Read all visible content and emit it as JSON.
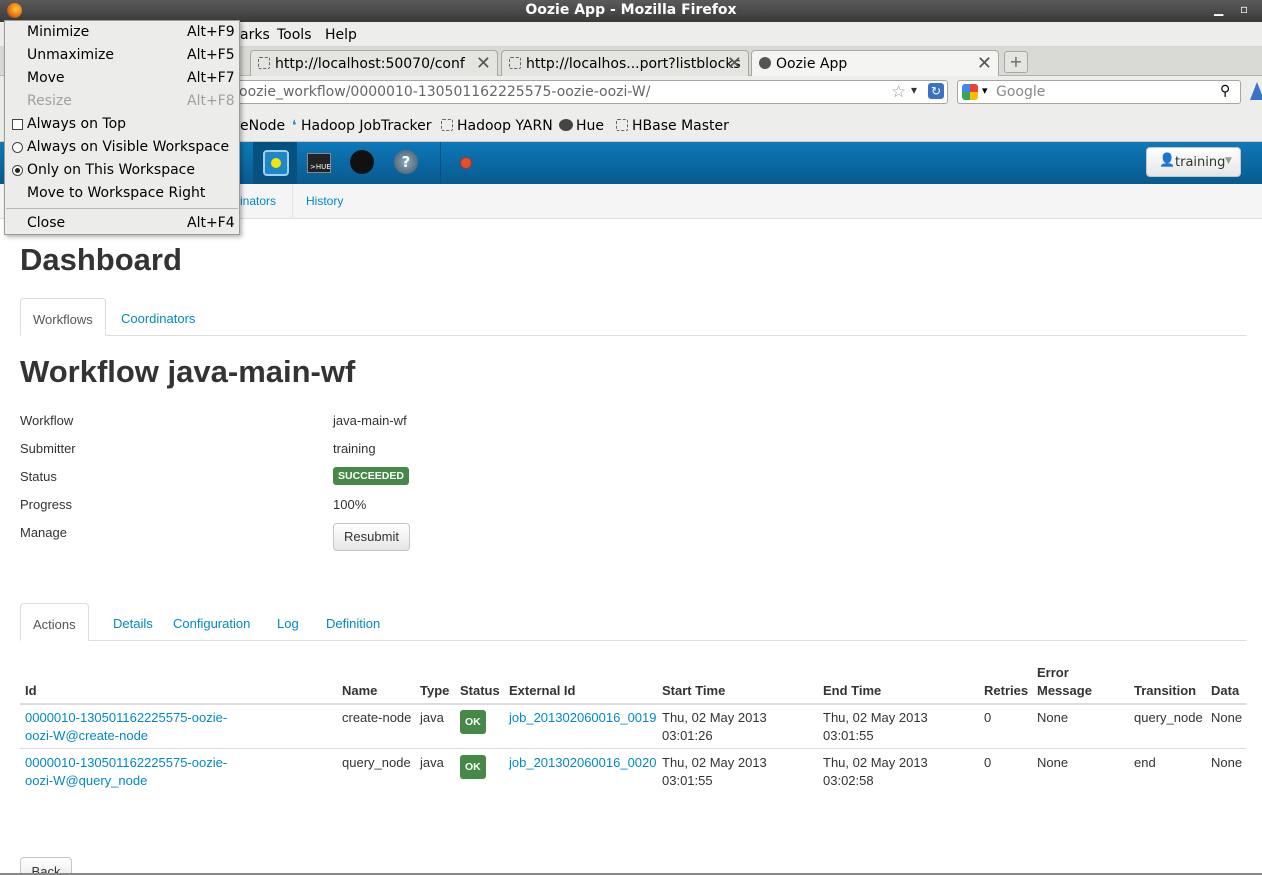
{
  "window": {
    "title": "Oozie App - Mozilla Firefox",
    "min_label": "▁",
    "close_label": "▫"
  },
  "menubar": {
    "bookmarks_partial": "arks",
    "tools": "Tools",
    "help": "Help"
  },
  "tabs": [
    {
      "label": "http://localhost:50070/conf"
    },
    {
      "label": "http://localhos...port?listblocks"
    },
    {
      "label": "Oozie App"
    }
  ],
  "newtab_label": "+",
  "url": "oozie_workflow/0000010-130501162225575-oozie-oozi-W/",
  "search": {
    "placeholder": "Google"
  },
  "bookmarks": [
    {
      "label": "eNode"
    },
    {
      "label": "Hadoop JobTracker"
    },
    {
      "label": "Hadoop YARN"
    },
    {
      "label": "Hue"
    },
    {
      "label": "HBase Master"
    }
  ],
  "hue_nav": {
    "user": "training",
    "hue_icon_text": ">HUE",
    "help_icon_text": "?"
  },
  "subnav": {
    "coordinators_partial": "inators",
    "history": "History"
  },
  "page_title": "Dashboard",
  "dashboard_tabs": {
    "workflows": "Workflows",
    "coordinators": "Coordinators"
  },
  "workflow_title": "Workflow java-main-wf",
  "properties": {
    "workflow": {
      "label": "Workflow",
      "value": "java-main-wf"
    },
    "submitter": {
      "label": "Submitter",
      "value": "training"
    },
    "status": {
      "label": "Status",
      "value": "SUCCEEDED"
    },
    "progress": {
      "label": "Progress",
      "value": "100%"
    },
    "manage": {
      "label": "Manage",
      "button": "Resubmit"
    }
  },
  "detail_tabs": {
    "actions": "Actions",
    "details": "Details",
    "configuration": "Configuration",
    "log": "Log",
    "definition": "Definition"
  },
  "actions_table": {
    "headers": {
      "id": "Id",
      "name": "Name",
      "type": "Type",
      "status": "Status",
      "external_id": "External Id",
      "start_time": "Start Time",
      "end_time": "End Time",
      "retries": "Retries",
      "error_message_1": "Error",
      "error_message_2": "Message",
      "transition": "Transition",
      "data": "Data"
    },
    "rows": [
      {
        "id_1": "0000010-130501162225575-oozie-",
        "id_2": "oozi-W@create-node",
        "name": "create-node",
        "type": "java",
        "status": "OK",
        "external_id": "job_201302060016_0019",
        "start_1": "Thu, 02 May 2013",
        "start_2": "03:01:26",
        "end_1": "Thu, 02 May 2013",
        "end_2": "03:01:55",
        "retries": "0",
        "error": "None",
        "transition": "query_node",
        "data": "None"
      },
      {
        "id_1": "0000010-130501162225575-oozie-",
        "id_2": "oozi-W@query_node",
        "name": "query_node",
        "type": "java",
        "status": "OK",
        "external_id": "job_201302060016_0020",
        "start_1": "Thu, 02 May 2013",
        "start_2": "03:01:55",
        "end_1": "Thu, 02 May 2013",
        "end_2": "03:02:58",
        "retries": "0",
        "error": "None",
        "transition": "end",
        "data": "None"
      }
    ]
  },
  "back_button": "Back",
  "context_menu": {
    "minimize": "Minimize",
    "minimize_acc": "Alt+F9",
    "unmaximize": "Unmaximize",
    "unmaximize_acc": "Alt+F5",
    "move": "Move",
    "move_acc": "Alt+F7",
    "resize": "Resize",
    "resize_acc": "Alt+F8",
    "always_on_top": "Always on Top",
    "always_visible": "Always on Visible Workspace",
    "only_this": "Only on This Workspace",
    "move_right": "Move to Workspace Right",
    "close": "Close",
    "close_acc": "Alt+F4"
  },
  "colors": {
    "hue_blue": "#0e78b8",
    "link": "#0088cc",
    "success": "#468847"
  }
}
